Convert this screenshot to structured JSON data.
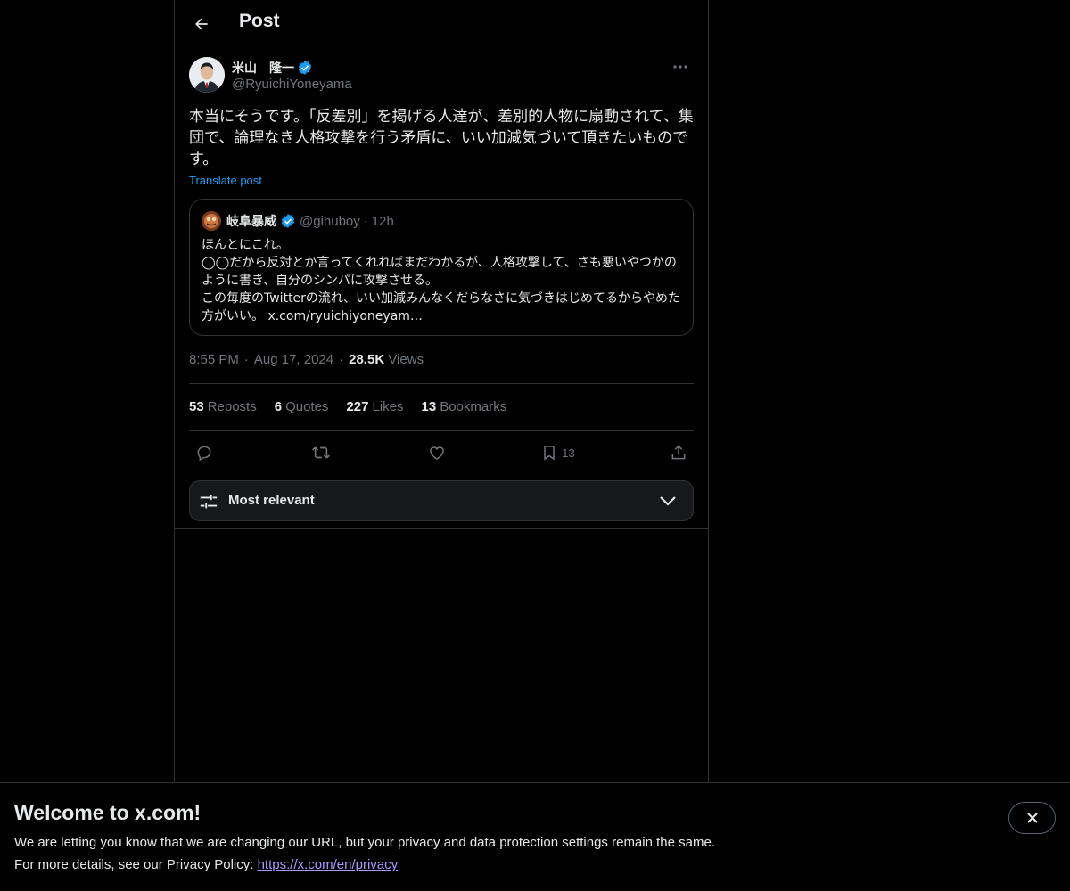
{
  "header": {
    "title": "Post"
  },
  "post": {
    "display_name": "米山　隆一",
    "handle": "@RyuichiYoneyama",
    "text": "本当にそうです。「反差別」を掲げる人達が、差別的人物に扇動されて、集団で、論理なき人格攻撃を行う矛盾に、いい加減気づいて頂きたいものです。",
    "translate_label": "Translate post",
    "time": "8:55 PM",
    "date": "Aug 17, 2024",
    "views_count": "28.5K",
    "views_label": "Views"
  },
  "quote": {
    "display_name": "岐阜暴威",
    "handle": "@gihuboy",
    "dot": "·",
    "time": "12h",
    "text": "ほんとにこれ。\n◯◯だから反対とか言ってくれればまだわかるが、人格攻撃して、さも悪いやつかのように書き、自分のシンパに攻撃させる。\nこの毎度のTwitterの流れ、いい加減みんなくだらなさに気づきはじめてるからやめた方がいい。 x.com/ryuichiyoneyam…"
  },
  "meta": {
    "dot": "·"
  },
  "stats": {
    "reposts_count": "53",
    "reposts_label": "Reposts",
    "quotes_count": "6",
    "quotes_label": "Quotes",
    "likes_count": "227",
    "likes_label": "Likes",
    "bookmarks_count": "13",
    "bookmarks_label": "Bookmarks"
  },
  "actions": {
    "bookmark_count": "13"
  },
  "sort": {
    "label": "Most relevant"
  },
  "banner": {
    "title": "Welcome to x.com!",
    "line1": "We are letting you know that we are changing our URL, but your privacy and data protection settings remain the same.",
    "line2_prefix": "For more details, see our Privacy Policy: ",
    "link": "https://x.com/en/privacy"
  },
  "colors": {
    "accent": "#1d9bf0",
    "muted": "#71767b",
    "border": "#2f3336",
    "link_purple": "#a999ff"
  },
  "icons": [
    "back-arrow-icon",
    "verified-badge-icon",
    "more-icon",
    "reply-icon",
    "repost-icon",
    "like-icon",
    "bookmark-icon",
    "share-icon",
    "sliders-icon",
    "chevron-down-icon",
    "close-icon"
  ]
}
